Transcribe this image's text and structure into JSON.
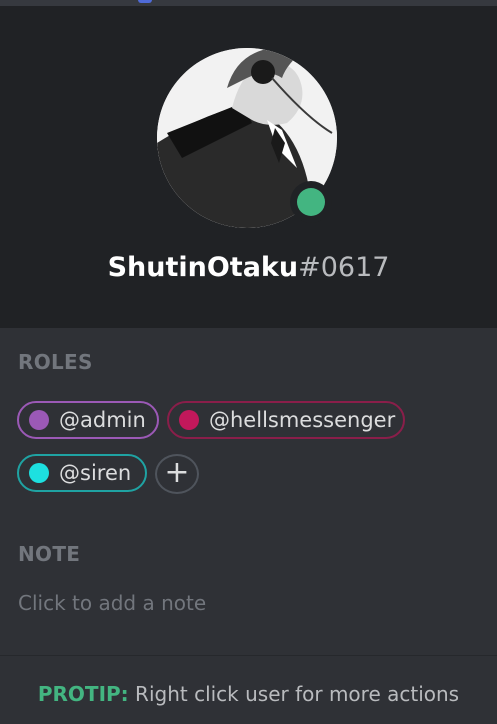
{
  "profile": {
    "username": "ShutinOtaku",
    "discriminator": "#0617",
    "status": "online",
    "avatar": "avatar-image"
  },
  "roles": {
    "title": "ROLES",
    "items": [
      {
        "label": "@admin",
        "color": "#9b59b6"
      },
      {
        "label": "@hellsmessenger",
        "color": "#c2185b"
      },
      {
        "label": "@siren",
        "color": "#1abc9c"
      }
    ],
    "add_icon": "plus-icon"
  },
  "note": {
    "title": "NOTE",
    "placeholder": "Click to add a note"
  },
  "protip": {
    "label": "PROTIP:",
    "text": "Right click user for more actions"
  },
  "colors": {
    "online": "#43b581",
    "header_bg": "#202225",
    "body_bg": "#2f3136"
  }
}
